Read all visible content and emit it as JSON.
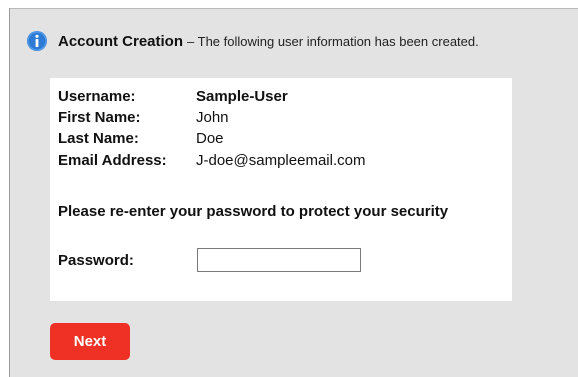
{
  "notice": {
    "icon": "info-icon",
    "title": "Account Creation",
    "message": "– The following user information has been created."
  },
  "fields": [
    {
      "label": "Username:",
      "value": "Sample-User"
    },
    {
      "label": "First Name:",
      "value": "John"
    },
    {
      "label": "Last Name:",
      "value": "Doe"
    },
    {
      "label": "Email Address:",
      "value": "J-doe@sampleemail.com"
    }
  ],
  "prompt": "Please re-enter your password to protect your security",
  "password": {
    "label": "Password:",
    "value": "",
    "placeholder": ""
  },
  "next_button": {
    "label": "Next"
  },
  "colors": {
    "info_icon": "#2e7bd6",
    "button": "#ee3124",
    "panel_background": "#e3e3e3"
  }
}
